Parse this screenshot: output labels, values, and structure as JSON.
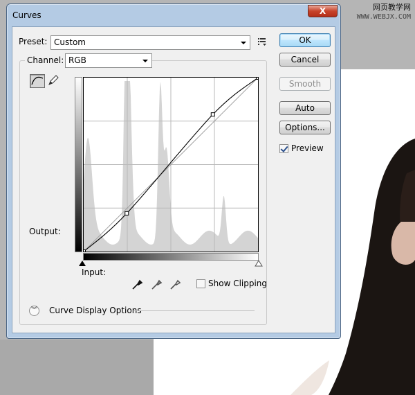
{
  "window": {
    "title": "Curves",
    "close_glyph": "X"
  },
  "watermark": {
    "line1": "网页教学网",
    "line2": "WWW.WEBJX.COM"
  },
  "preset": {
    "label": "Preset:",
    "value": "Custom",
    "menu_icon": "list-menu-icon"
  },
  "channel": {
    "label": "Channel:",
    "value": "RGB"
  },
  "buttons": {
    "ok": "OK",
    "cancel": "Cancel",
    "smooth": "Smooth",
    "auto": "Auto",
    "options": "Options..."
  },
  "preview": {
    "label": "Preview",
    "checked": true
  },
  "graph": {
    "output_label": "Output:",
    "input_label": "Input:",
    "control_points": [
      {
        "input": 0,
        "output": 0
      },
      {
        "input": 63,
        "output": 56
      },
      {
        "input": 189,
        "output": 201
      },
      {
        "input": 255,
        "output": 255
      }
    ]
  },
  "show_clipping": {
    "label": "Show Clipping",
    "checked": false
  },
  "curve_display_options": {
    "label": "Curve Display Options"
  },
  "colors": {
    "dialog_frame": "#b4cbe4",
    "histogram": "#d4d4d4",
    "close_button": "#c7432a"
  }
}
